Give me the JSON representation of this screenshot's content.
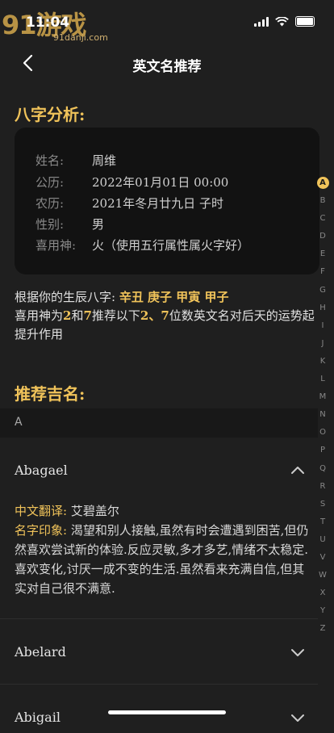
{
  "status": {
    "time": "11:04",
    "watermark": "91游戏",
    "watermark_url": "91danji.com"
  },
  "nav": {
    "title": "英文名推荐"
  },
  "bazi": {
    "title": "八字分析:",
    "rows": [
      {
        "label": "姓名:",
        "value": "周维"
      },
      {
        "label": "公历:",
        "value": "2022年01月01日 00:00"
      },
      {
        "label": "农历:",
        "value": "2021年冬月廿九日 子时"
      },
      {
        "label": "性别:",
        "value": "男"
      },
      {
        "label": "喜用神:",
        "value": "火（使用五行属性属火字好）"
      }
    ]
  },
  "analysis": {
    "prefix": "根据你的生辰八字: ",
    "bazi": "辛丑 庚子 甲寅 甲子",
    "line2_a": "喜用神为",
    "n1": "2",
    "and": "和",
    "n2": "7",
    "line2_b": "推荐以下",
    "nums": "2、7",
    "line2_c": "位数英文名对后天的运势起提升作用"
  },
  "recommend": {
    "title": "推荐吉名:"
  },
  "group": {
    "letter": "A"
  },
  "names": [
    {
      "name": "Abagael",
      "expanded": true,
      "translation_label": "中文翻译: ",
      "translation": "艾碧盖尔",
      "impression_label": "名字印象: ",
      "impression": "渴望和别人接触,虽然有时会遭遇到困苦,但仍然喜欢尝试新的体验.反应灵敏,多才多艺,情绪不太稳定.喜欢变化,讨厌一成不变的生活.虽然看来充满自信,但其实对自己很不满意."
    },
    {
      "name": "Abelard",
      "expanded": false
    },
    {
      "name": "Abigail",
      "expanded": false
    }
  ],
  "index": [
    "A",
    "B",
    "C",
    "D",
    "E",
    "F",
    "G",
    "H",
    "I",
    "J",
    "K",
    "L",
    "M",
    "N",
    "O",
    "P",
    "Q",
    "R",
    "S",
    "T",
    "U",
    "V",
    "W",
    "X",
    "Y",
    "Z"
  ],
  "colors": {
    "accent": "#f0c35a",
    "background": "#1f1f1f",
    "card": "#121212"
  }
}
